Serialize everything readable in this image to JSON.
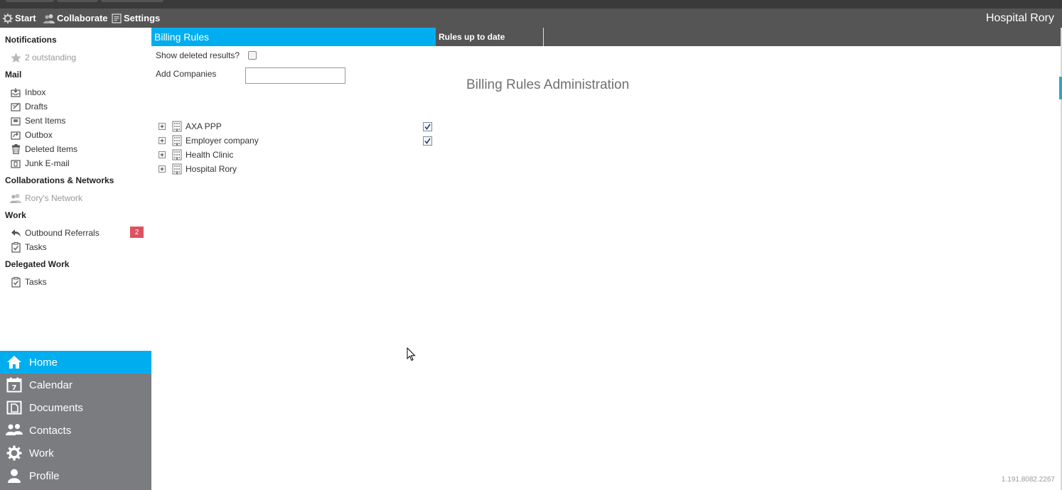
{
  "menubar": {
    "start_label": "Start",
    "collaborate_label": "Collaborate",
    "settings_label": "Settings",
    "app_title": "Hospital Rory"
  },
  "sidebar": {
    "notifications": {
      "heading": "Notifications",
      "outstanding": "2 outstanding"
    },
    "mail": {
      "heading": "Mail",
      "items": [
        "Inbox",
        "Drafts",
        "Sent Items",
        "Outbox",
        "Deleted Items",
        "Junk E-mail"
      ]
    },
    "collaborations": {
      "heading": "Collaborations & Networks",
      "network": "Rory's Network"
    },
    "work": {
      "heading": "Work",
      "outbound_referrals": "Outbound Referrals",
      "outbound_count": "2",
      "tasks": "Tasks"
    },
    "delegated": {
      "heading": "Delegated Work",
      "tasks": "Tasks"
    }
  },
  "bottom_nav": {
    "items": [
      "Home",
      "Calendar",
      "Documents",
      "Contacts",
      "Work",
      "Profile"
    ],
    "active": "Home"
  },
  "tabs": {
    "active_label": "Billing Rules",
    "second_label": "Rules up to date"
  },
  "form": {
    "show_deleted_label": "Show deleted results?",
    "show_deleted_checked": false,
    "add_companies_label": "Add Companies",
    "add_companies_value": ""
  },
  "page_heading": "Billing Rules Administration",
  "companies": [
    {
      "name": "AXA PPP",
      "checked": true
    },
    {
      "name": "Employer company",
      "checked": true
    },
    {
      "name": "Health Clinic",
      "checked": false
    },
    {
      "name": "Hospital Rory",
      "checked": false
    }
  ],
  "version": "1.191.8082.2267",
  "colors": {
    "accent": "#00aeef",
    "bar": "#555556",
    "nav": "#7b7c7f",
    "badge": "#e0505f"
  }
}
